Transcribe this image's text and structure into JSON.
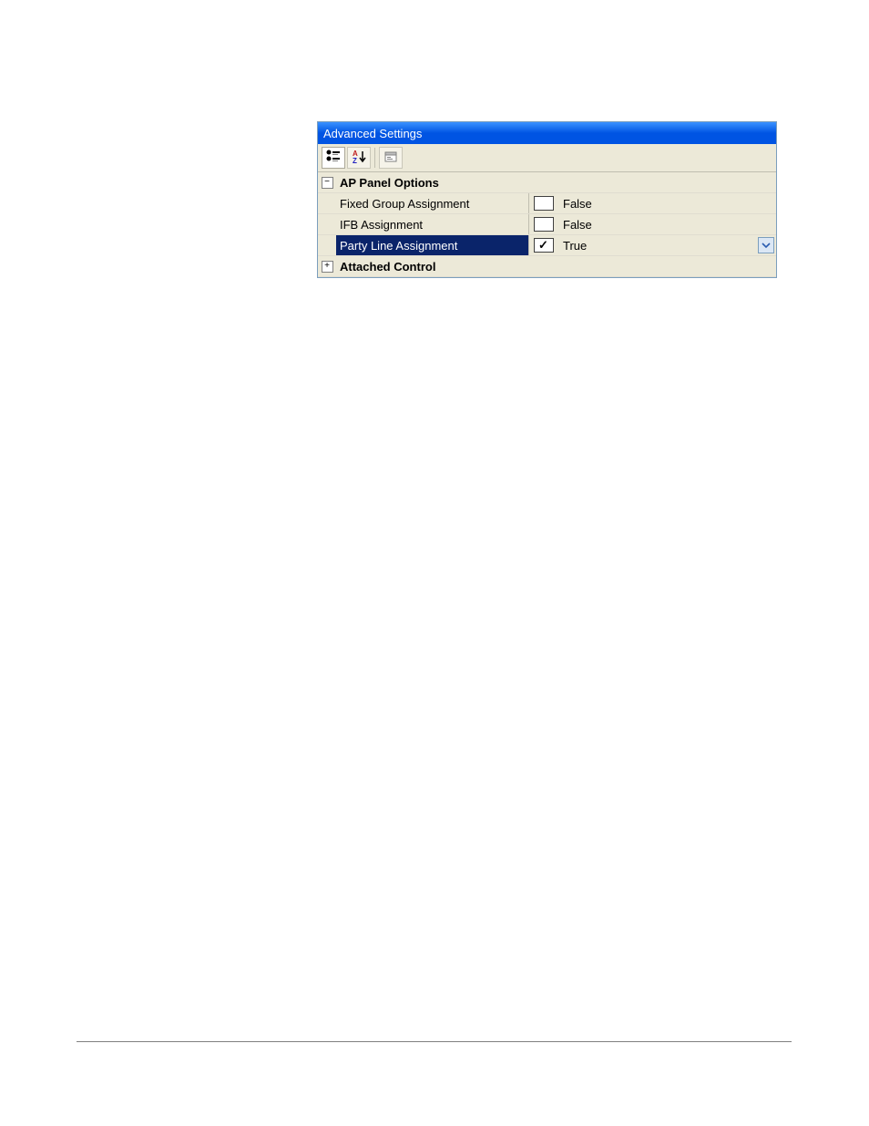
{
  "title": "Advanced Settings",
  "toolbar": {
    "categorized_icon": "categorized-icon",
    "alpha_icon": "alpha-sort-icon",
    "properties_icon": "property-pages-icon"
  },
  "groups": [
    {
      "expanded": true,
      "symbol": "−",
      "label": "AP Panel Options",
      "rows": [
        {
          "name": "Fixed Group Assignment",
          "checked": false,
          "value": "False",
          "selected": false
        },
        {
          "name": "IFB Assignment",
          "checked": false,
          "value": "False",
          "selected": false
        },
        {
          "name": "Party Line Assignment",
          "checked": true,
          "value": "True",
          "selected": true
        }
      ]
    },
    {
      "expanded": false,
      "symbol": "+",
      "label": "Attached Control",
      "rows": []
    }
  ]
}
